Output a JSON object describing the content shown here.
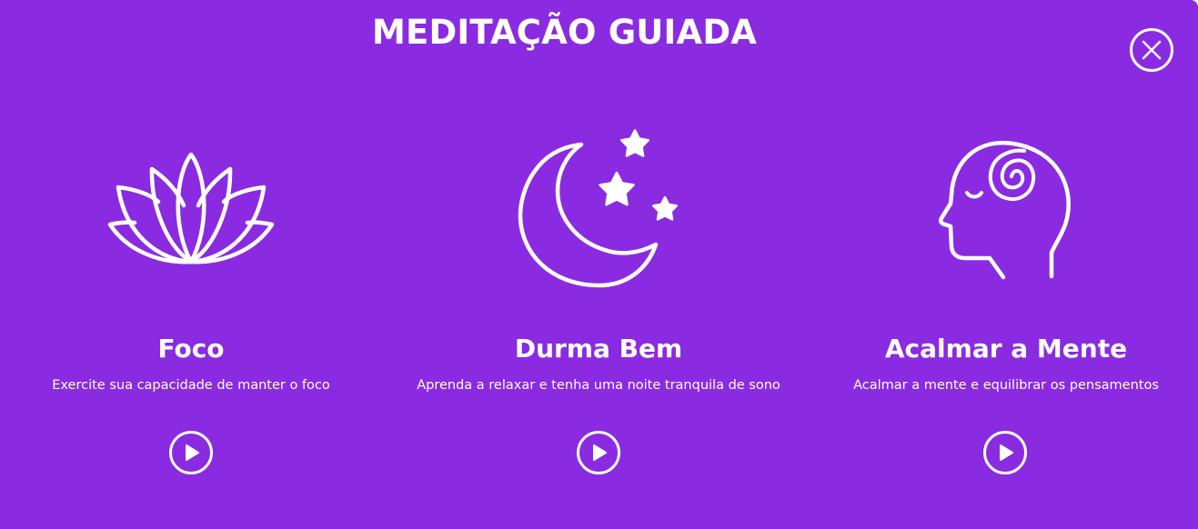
{
  "header": {
    "title": "MEDITAÇÃO GUIADA",
    "close_icon": "close-icon"
  },
  "colors": {
    "background": "#8a2be2",
    "foreground": "#ffffff"
  },
  "cards": [
    {
      "title": "Foco",
      "description": "Exercite sua capacidade de manter o foco",
      "icon": "lotus-icon",
      "action_icon": "play-icon"
    },
    {
      "title": "Durma Bem",
      "description": "Aprenda a relaxar e tenha uma noite tranquila de sono",
      "icon": "moon-stars-icon",
      "action_icon": "play-icon"
    },
    {
      "title": "Acalmar a Mente",
      "description": "Acalmar a mente e equilibrar os pensamentos",
      "icon": "head-spiral-icon",
      "action_icon": "play-icon"
    }
  ]
}
